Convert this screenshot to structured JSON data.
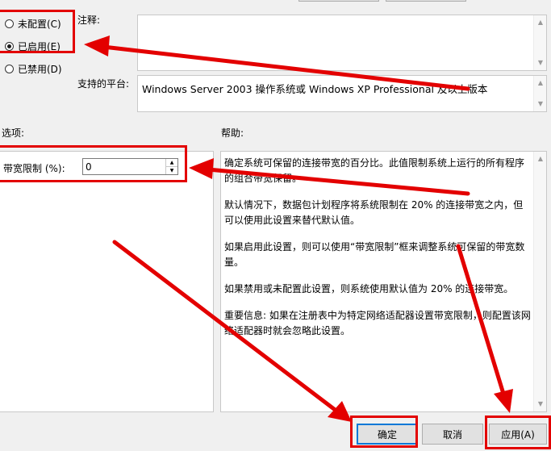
{
  "state_options": [
    {
      "label": "未配置(C)",
      "checked": false
    },
    {
      "label": "已启用(E)",
      "checked": true
    },
    {
      "label": "已禁用(D)",
      "checked": false
    }
  ],
  "comment": {
    "label": "注释:",
    "value": ""
  },
  "platform": {
    "label": "支持的平台:",
    "value": "Windows Server 2003 操作系统或 Windows XP Professional 及以上版本"
  },
  "options": {
    "label": "选项:",
    "field_label": "带宽限制 (%):",
    "value": "0"
  },
  "help": {
    "label": "帮助:",
    "paragraphs": [
      "确定系统可保留的连接带宽的百分比。此值限制系统上运行的所有程序的组合带宽保留。",
      "默认情况下，数据包计划程序将系统限制在 20% 的连接带宽之内，但可以使用此设置来替代默认值。",
      "如果启用此设置，则可以使用“带宽限制”框来调整系统可保留的带宽数量。",
      "如果禁用或未配置此设置，则系统使用默认值为 20% 的连接带宽。",
      "重要信息: 如果在注册表中为特定网络适配器设置带宽限制，则配置该网络适配器时就会忽略此设置。"
    ]
  },
  "buttons": {
    "ok": "确定",
    "cancel": "取消",
    "apply": "应用(A)"
  },
  "annotation_color": "#e30000"
}
